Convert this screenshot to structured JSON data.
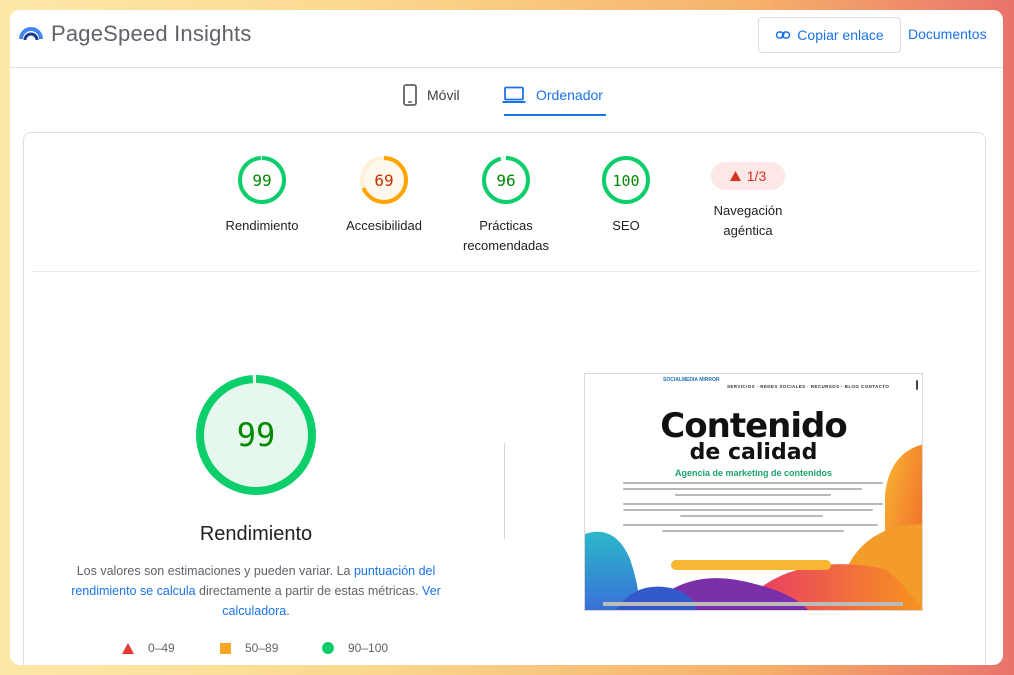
{
  "header": {
    "app_title": "PageSpeed Insights",
    "copy_link_label": "Copiar enlace",
    "docs_label": "Documentos"
  },
  "tabs": [
    {
      "label": "Móvil",
      "icon": "phone-icon",
      "active": false
    },
    {
      "label": "Ordenador",
      "icon": "laptop-icon",
      "active": true
    }
  ],
  "categories": [
    {
      "score": "99",
      "label_line1": "Rendimiento",
      "label_line2": "",
      "status": "pass"
    },
    {
      "score": "69",
      "label_line1": "Accesibilidad",
      "label_line2": "",
      "status": "average"
    },
    {
      "score": "96",
      "label_line1": "Prácticas",
      "label_line2": "recomendadas",
      "status": "pass"
    },
    {
      "score": "100",
      "label_line1": "SEO",
      "label_line2": "",
      "status": "pass"
    },
    {
      "score": "1/3",
      "label_line1": "Navegación",
      "label_line2": "agéntica",
      "status": "fail"
    }
  ],
  "summary": {
    "score": "99",
    "title": "Rendimiento",
    "disclaimer_pre": "Los valores son estimaciones y pueden variar. La ",
    "disclaimer_link1": "puntuación del rendimiento se calcula",
    "disclaimer_mid": " directamente a partir de estas métricas. ",
    "disclaimer_link2": "Ver calculadora",
    "disclaimer_post": "."
  },
  "legend": [
    {
      "range": "0–49",
      "shape": "triangle",
      "color": "#e53935"
    },
    {
      "range": "50–89",
      "shape": "square",
      "color": "#f5a623"
    },
    {
      "range": "90–100",
      "shape": "circle",
      "color": "#0cce6b"
    }
  ],
  "preview": {
    "brand": "SOCIALMEDIA MIRROR",
    "menu": "SERVICIOS ·   REDES SOCIALES ·   RECURSOS ·   BLOG   CONTACTO",
    "headline1": "Contenido",
    "headline2": "de calidad",
    "subheadline": "Agencia de marketing de contenidos"
  },
  "colors": {
    "pass": "#0cce6b",
    "pass_text": "#008800",
    "average": "#ffa400",
    "average_text": "#c33300",
    "fail": "#d93025",
    "accent": "#1a73e8"
  }
}
